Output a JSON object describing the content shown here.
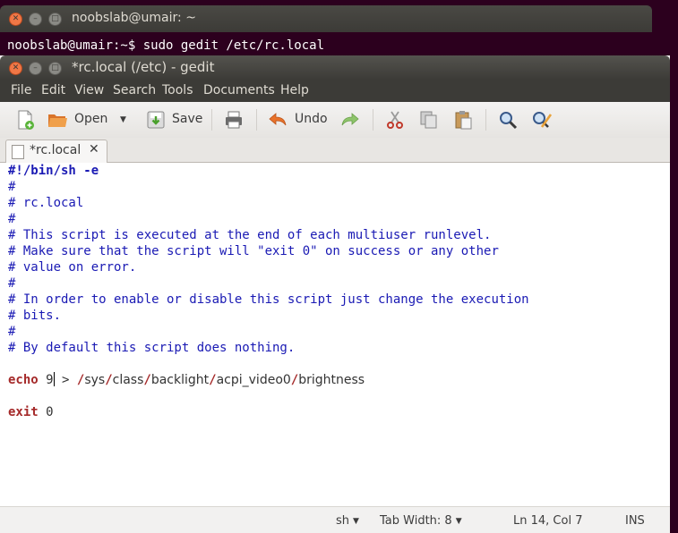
{
  "terminal": {
    "title": "noobslab@umair: ~",
    "command_line": "noobslab@umair:~$ sudo gedit /etc/rc.local"
  },
  "gedit": {
    "title": "*rc.local (/etc) - gedit",
    "menu": [
      "File",
      "Edit",
      "View",
      "Search",
      "Tools",
      "Documents",
      "Help"
    ],
    "toolbar": {
      "open_label": "Open",
      "save_label": "Save",
      "undo_label": "Undo"
    },
    "tab_label": "*rc.local",
    "tab_close": "✕",
    "code": {
      "l1": "#!/bin/sh -e",
      "l2": "#",
      "l3": "# rc.local",
      "l4": "#",
      "l5": "# This script is executed at the end of each multiuser runlevel.",
      "l6": "# Make sure that the script will \"exit 0\" on success or any other",
      "l7": "# value on error.",
      "l8": "#",
      "l9": "# In order to enable or disable this script just change the execution",
      "l10": "# bits.",
      "l11": "#",
      "l12": "# By default this script does nothing.",
      "l14_kw": "echo",
      "l14_val": "9",
      "l14_redirect": " > ",
      "l14_path": [
        "/",
        "sys",
        "/",
        "class",
        "/",
        "backlight",
        "/",
        "acpi_video0",
        "/",
        "brightness"
      ],
      "l16_kw": "exit",
      "l16_val": "0"
    },
    "status": {
      "language": "sh",
      "tab_width": "Tab Width: 8",
      "position": "Ln 14, Col 7",
      "mode": "INS"
    }
  },
  "icons": [
    "new-document-icon",
    "open-folder-icon",
    "save-icon",
    "print-icon",
    "undo-icon",
    "redo-icon",
    "cut-icon",
    "copy-icon",
    "paste-icon",
    "find-icon",
    "replace-icon"
  ]
}
